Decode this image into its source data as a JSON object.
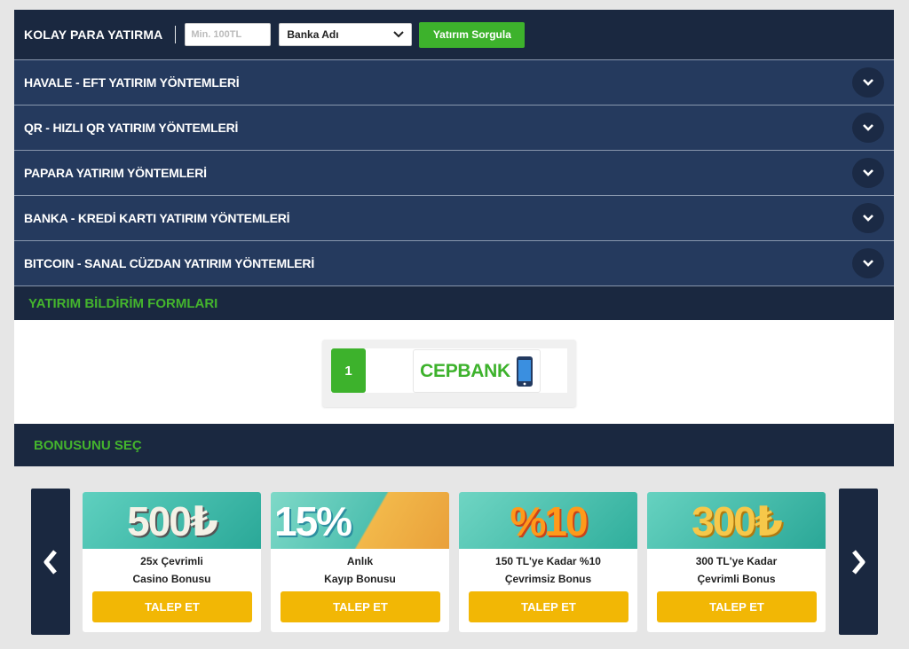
{
  "deposit": {
    "title": "KOLAY PARA YATIRMA",
    "amount_placeholder": "Min. 100TL",
    "bank_selected": "Banka Adı",
    "query_button": "Yatırım Sorgula"
  },
  "methods": [
    {
      "label": "HAVALE - EFT YATIRIM YÖNTEMLERİ"
    },
    {
      "label": "QR - HIZLI QR YATIRIM YÖNTEMLERİ"
    },
    {
      "label": "PAPARA YATIRIM YÖNTEMLERİ"
    },
    {
      "label": "BANKA - KREDİ KARTI YATIRIM YÖNTEMLERİ"
    },
    {
      "label": "BITCOIN - SANAL CÜZDAN YATIRIM YÖNTEMLERİ"
    }
  ],
  "forms": {
    "title": "YATIRIM BİLDİRİM FORMLARI",
    "items": [
      {
        "number": "1",
        "brand": "CEPBANK",
        "icon": "mobile-phone-icon"
      }
    ]
  },
  "bonus": {
    "title": "BONUSUNU SEÇ",
    "prev_icon": "chevron-left-icon",
    "next_icon": "chevron-right-icon",
    "cards": [
      {
        "banner_text": "500₺",
        "line1": "25x Çevrimli",
        "line2": "Casino Bonusu",
        "button": "TALEP ET",
        "color": "#34b8a8"
      },
      {
        "banner_text": "15%",
        "line1": "Anlık",
        "line2": "Kayıp Bonusu",
        "button": "TALEP ET",
        "color": "#4ac1b0"
      },
      {
        "banner_text": "%10",
        "line1": "150 TL'ye Kadar %10",
        "line2": "Çevrimsiz Bonus",
        "button": "TALEP ET",
        "color": "#3cbca6"
      },
      {
        "banner_text": "300₺",
        "line1": "300 TL'ye Kadar",
        "line2": "Çevrimli Bonus",
        "button": "TALEP ET",
        "color": "#38b6a8"
      }
    ]
  },
  "colors": {
    "navy": "#1a2840",
    "accordion": "#253a5e",
    "green": "#3db22c",
    "yellow": "#f2b705"
  }
}
